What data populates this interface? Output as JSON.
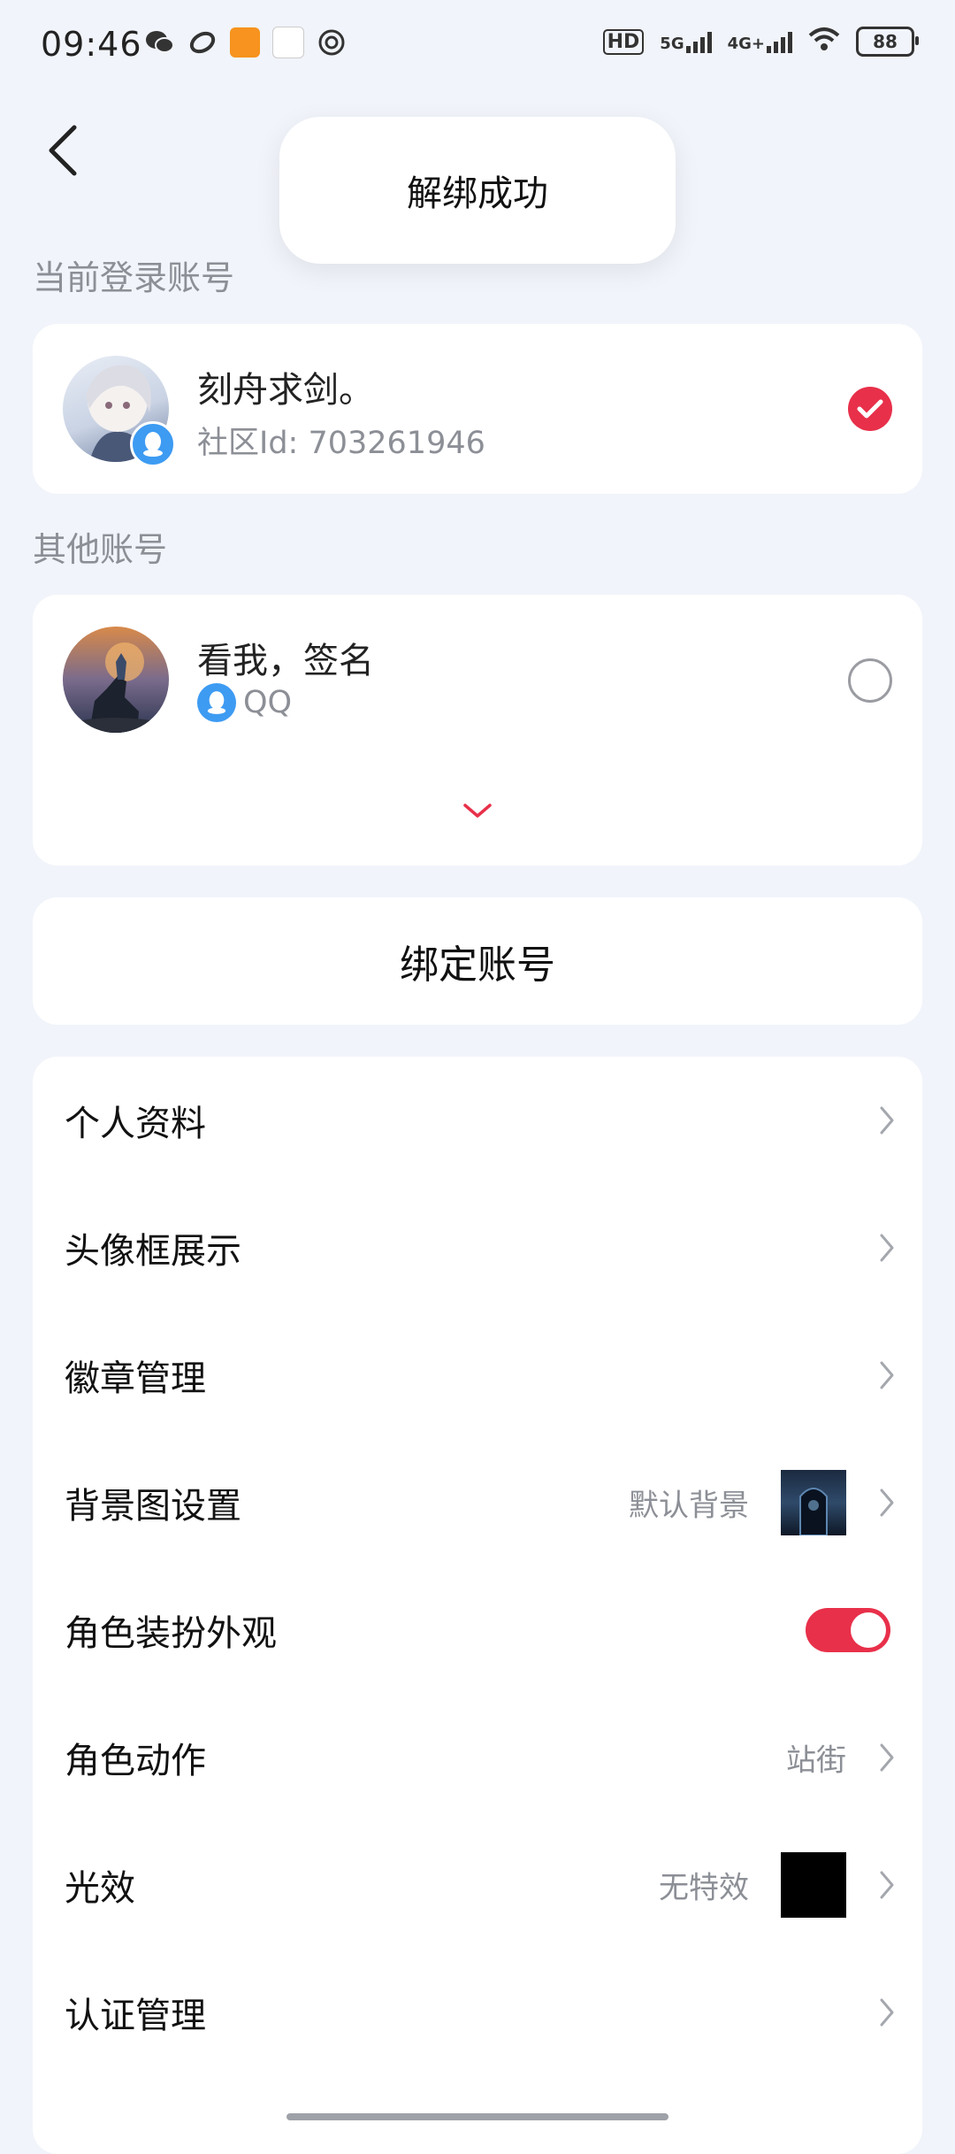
{
  "status_bar": {
    "time": "09:46",
    "network_left": "HD",
    "network_5g": "5G",
    "network_4g": "4G+",
    "battery": "88"
  },
  "toast": {
    "message": "解绑成功"
  },
  "current_account": {
    "section_label": "当前登录账号",
    "name": "刻舟求剑。",
    "sub": "社区Id: 703261946",
    "selected": true
  },
  "other_accounts": {
    "section_label": "其他账号",
    "items": [
      {
        "name": "看我，签名",
        "sub": "QQ",
        "selected": false
      }
    ]
  },
  "bind_button": {
    "label": "绑定账号"
  },
  "menu": {
    "items": [
      {
        "label": "个人资料",
        "value": ""
      },
      {
        "label": "头像框展示",
        "value": ""
      },
      {
        "label": "徽章管理",
        "value": ""
      },
      {
        "label": "背景图设置",
        "value": "默认背景"
      },
      {
        "label": "角色装扮外观",
        "value": "",
        "toggle_on": true
      },
      {
        "label": "角色动作",
        "value": "站街"
      },
      {
        "label": "光效",
        "value": "无特效"
      },
      {
        "label": "认证管理",
        "value": ""
      }
    ]
  },
  "colors": {
    "accent": "#e8304a",
    "qq_blue": "#3d9bf2",
    "background": "#f1f4fa",
    "muted_text": "#8c8f96"
  }
}
